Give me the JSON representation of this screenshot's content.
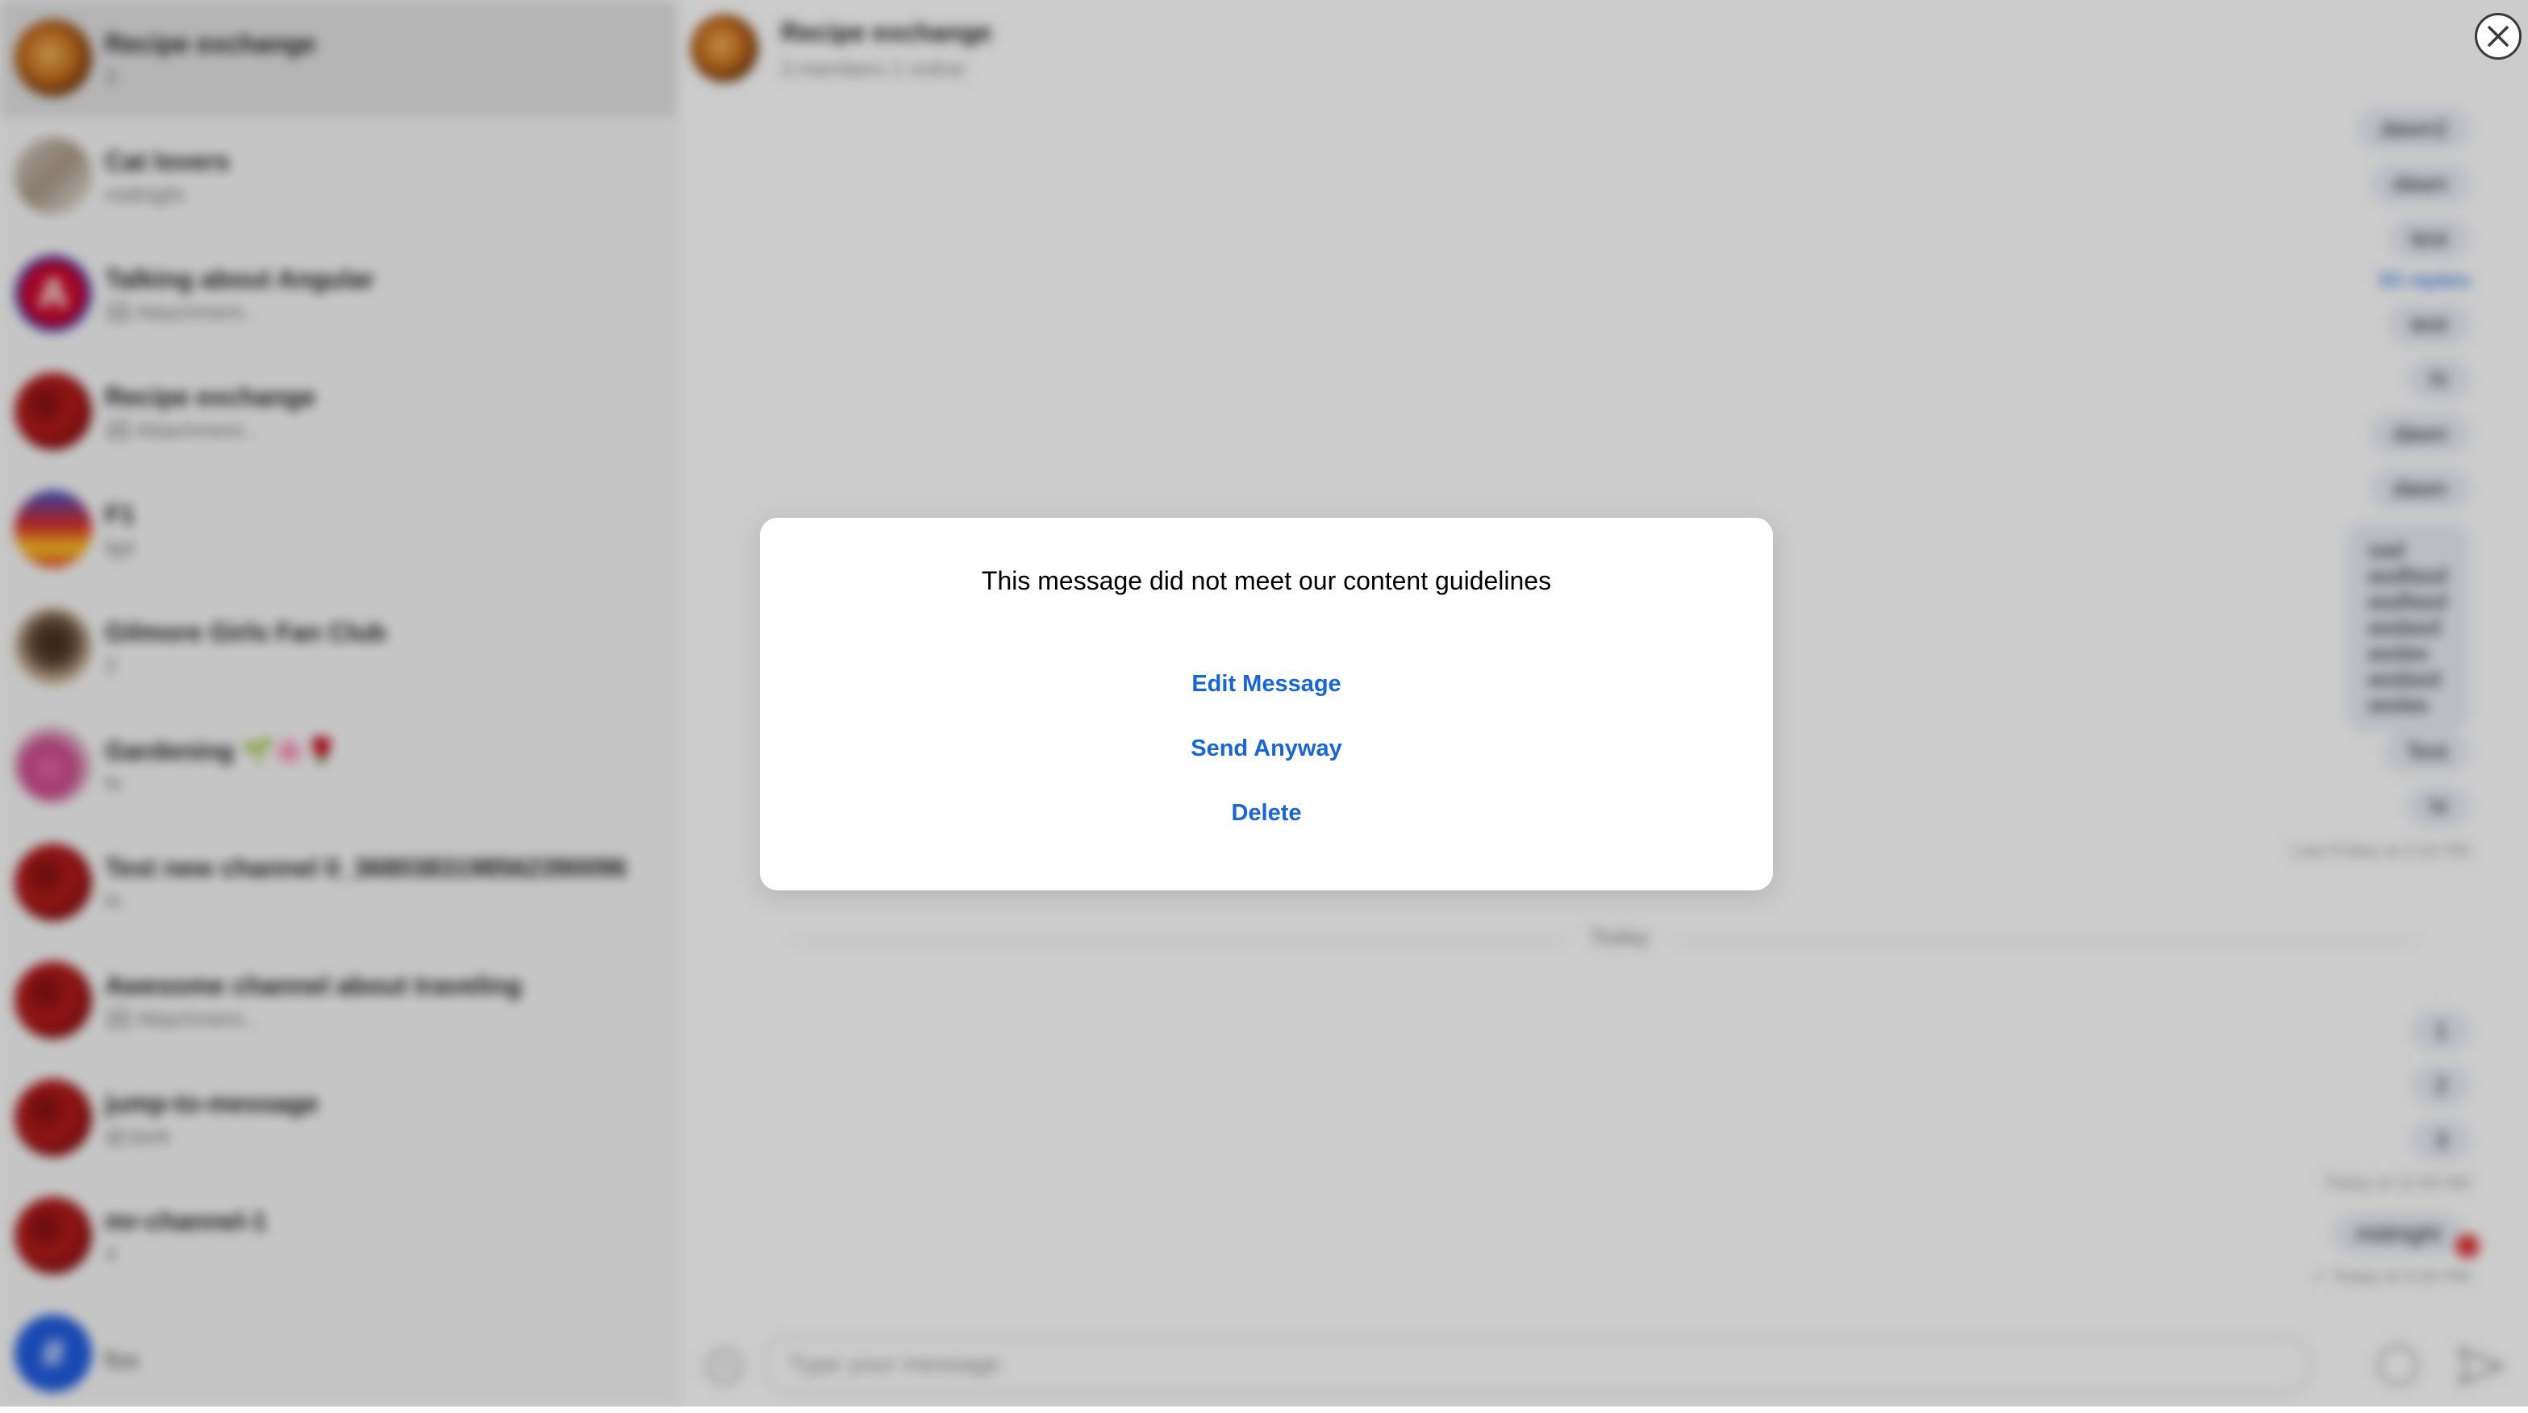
{
  "sidebar": {
    "channels": [
      {
        "name": "Recipe exchange",
        "preview": "3",
        "active": true
      },
      {
        "name": "Cat lovers",
        "preview": "midnight"
      },
      {
        "name": "Talking about Angular",
        "preview": "🏞 Attachment..."
      },
      {
        "name": "Recipe exchange",
        "preview": "🏞 Attachment..."
      },
      {
        "name": "F1",
        "preview": "fgd"
      },
      {
        "name": "Gilmore Girls Fan Club",
        "preview": "2"
      },
      {
        "name": "Gardening 🌱🌸🌹",
        "preview": "hi"
      },
      {
        "name": "Test new channel 0_3680383198562390096",
        "preview": "hi"
      },
      {
        "name": "Awesome channel about traveling",
        "preview": "🏞 Attachment..."
      },
      {
        "name": "jump-to-message",
        "preview": "@Jank"
      },
      {
        "name": "mr-channel-1",
        "preview": "4"
      },
      {
        "name": "fox",
        "preview": ""
      }
    ],
    "avatar_initials": {
      "angular": "A",
      "hash": "#"
    }
  },
  "chat": {
    "title": "Recipe exchange",
    "subtitle": "3 members 1 online",
    "messages": {
      "m1": "dawn2",
      "m2": "dawn",
      "m3": "test",
      "replies": "93 replies",
      "m4": "test",
      "m5": "hi",
      "m6": "dawn",
      "m7": "dawn",
      "m8_lines": [
        "sad",
        "asdfasd",
        "asdfasd",
        "asdasd",
        "asdas",
        "asdasd",
        "asdas"
      ],
      "m9": "Test",
      "m10": "hi",
      "ts1": "Last Friday at 3:16 PM",
      "divider": "Today",
      "m11": "1",
      "m12": "2",
      "m13": "3",
      "ts2": "Today at 11:00 AM",
      "m14": "midnight",
      "ts3": "✓ Today at 4:26 PM"
    },
    "composer_placeholder": "Type your message"
  },
  "modal": {
    "message": "This message did not meet our content guidelines",
    "edit_label": "Edit Message",
    "send_label": "Send Anyway",
    "delete_label": "Delete"
  },
  "colors": {
    "accent": "#1766d1",
    "bubble": "#e9eef6",
    "error": "#e23b3b",
    "overlay": "rgba(0,0,0,0.20)"
  },
  "icons": [
    "close-icon",
    "attach-icon",
    "emoji-icon",
    "send-icon"
  ]
}
